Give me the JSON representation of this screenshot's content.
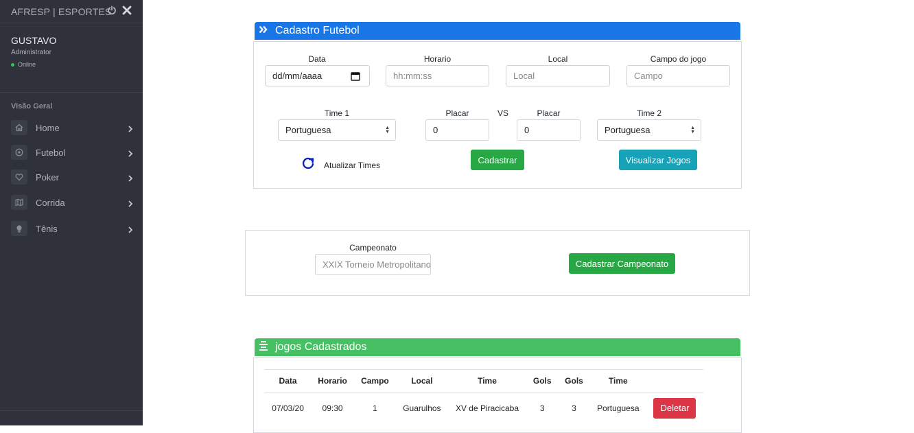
{
  "sidebar": {
    "brand": "AFRESP | ESPORTES",
    "user": {
      "name": "GUSTAVO",
      "role": "Administrator",
      "status": "Online"
    },
    "section_title": "Visão Geral",
    "items": [
      {
        "label": "Home",
        "icon": "home-icon"
      },
      {
        "label": "Futebol",
        "icon": "soccer-ball-icon"
      },
      {
        "label": "Poker",
        "icon": "heart-icon"
      },
      {
        "label": "Corrida",
        "icon": "map-icon"
      },
      {
        "label": "Tênis",
        "icon": "tennis-icon"
      }
    ]
  },
  "cadastro": {
    "title": "Cadastro Futebol",
    "header_color": "#1976e6",
    "fields": {
      "data_label": "Data",
      "data_value": "dd/mm/aaaa",
      "horario_label": "Horario",
      "horario_placeholder": "hh:mm:ss",
      "local_label": "Local",
      "local_placeholder": "Local",
      "campo_label": "Campo do jogo",
      "campo_placeholder": "Campo",
      "time1_label": "Time 1",
      "time1_value": "Portuguesa",
      "placar1_label": "Placar",
      "placar1_value": "0",
      "vs_label": "VS",
      "placar2_label": "Placar",
      "placar2_value": "0",
      "time2_label": "Time 2",
      "time2_value": "Portuguesa"
    },
    "refresh_label": "Atualizar Times",
    "submit_label": "Cadastrar",
    "view_label": "Visualizar Jogos"
  },
  "campeonato": {
    "label": "Campeonato",
    "placeholder": "XXIX Torneio Metropolitano",
    "submit_label": "Cadastrar Campeonato"
  },
  "jogos": {
    "title": "jogos Cadastrados",
    "header_color": "#47c064",
    "columns": [
      "Data",
      "Horario",
      "Campo",
      "Local",
      "Time",
      "Gols",
      "Gols",
      "Time",
      ""
    ],
    "rows": [
      {
        "data": "07/03/20",
        "horario": "09:30",
        "campo": "1",
        "local": "Guarulhos",
        "time1": "XV de Piracicaba",
        "gols1": "3",
        "gols2": "3",
        "time2": "Portuguesa",
        "action": "Deletar"
      }
    ]
  }
}
